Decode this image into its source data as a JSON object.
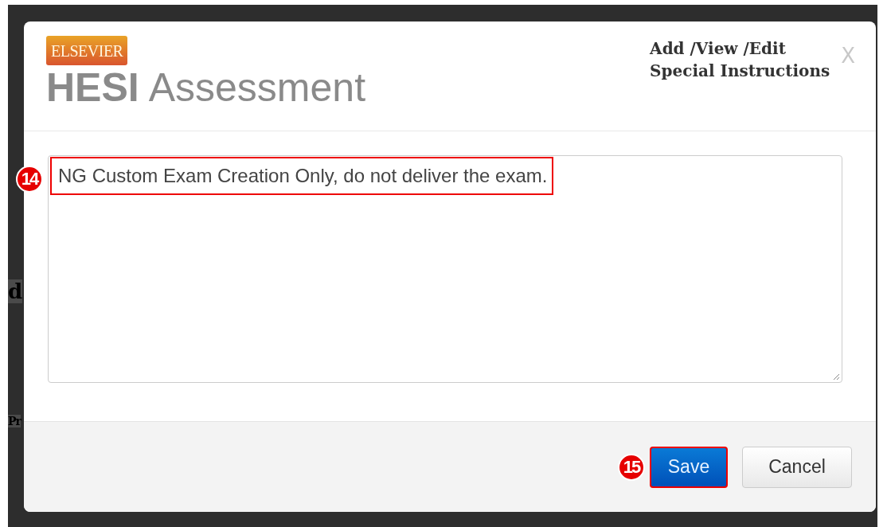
{
  "background_fragments": [
    "d",
    "Pr"
  ],
  "dialog": {
    "logo_badge": "ELSEVIER",
    "logo_bold": "HESI",
    "logo_text": "Assessment",
    "title": "Add /View /Edit\nSpecial Instructions",
    "close": "X",
    "instructions_value": "NG Custom Exam Creation Only, do not deliver the exam.",
    "callouts": [
      {
        "number": "14"
      },
      {
        "number": "15"
      }
    ],
    "buttons": [
      {
        "label": "Save",
        "kind": "primary",
        "highlighted": true
      },
      {
        "label": "Cancel",
        "kind": "secondary",
        "highlighted": false
      }
    ]
  }
}
